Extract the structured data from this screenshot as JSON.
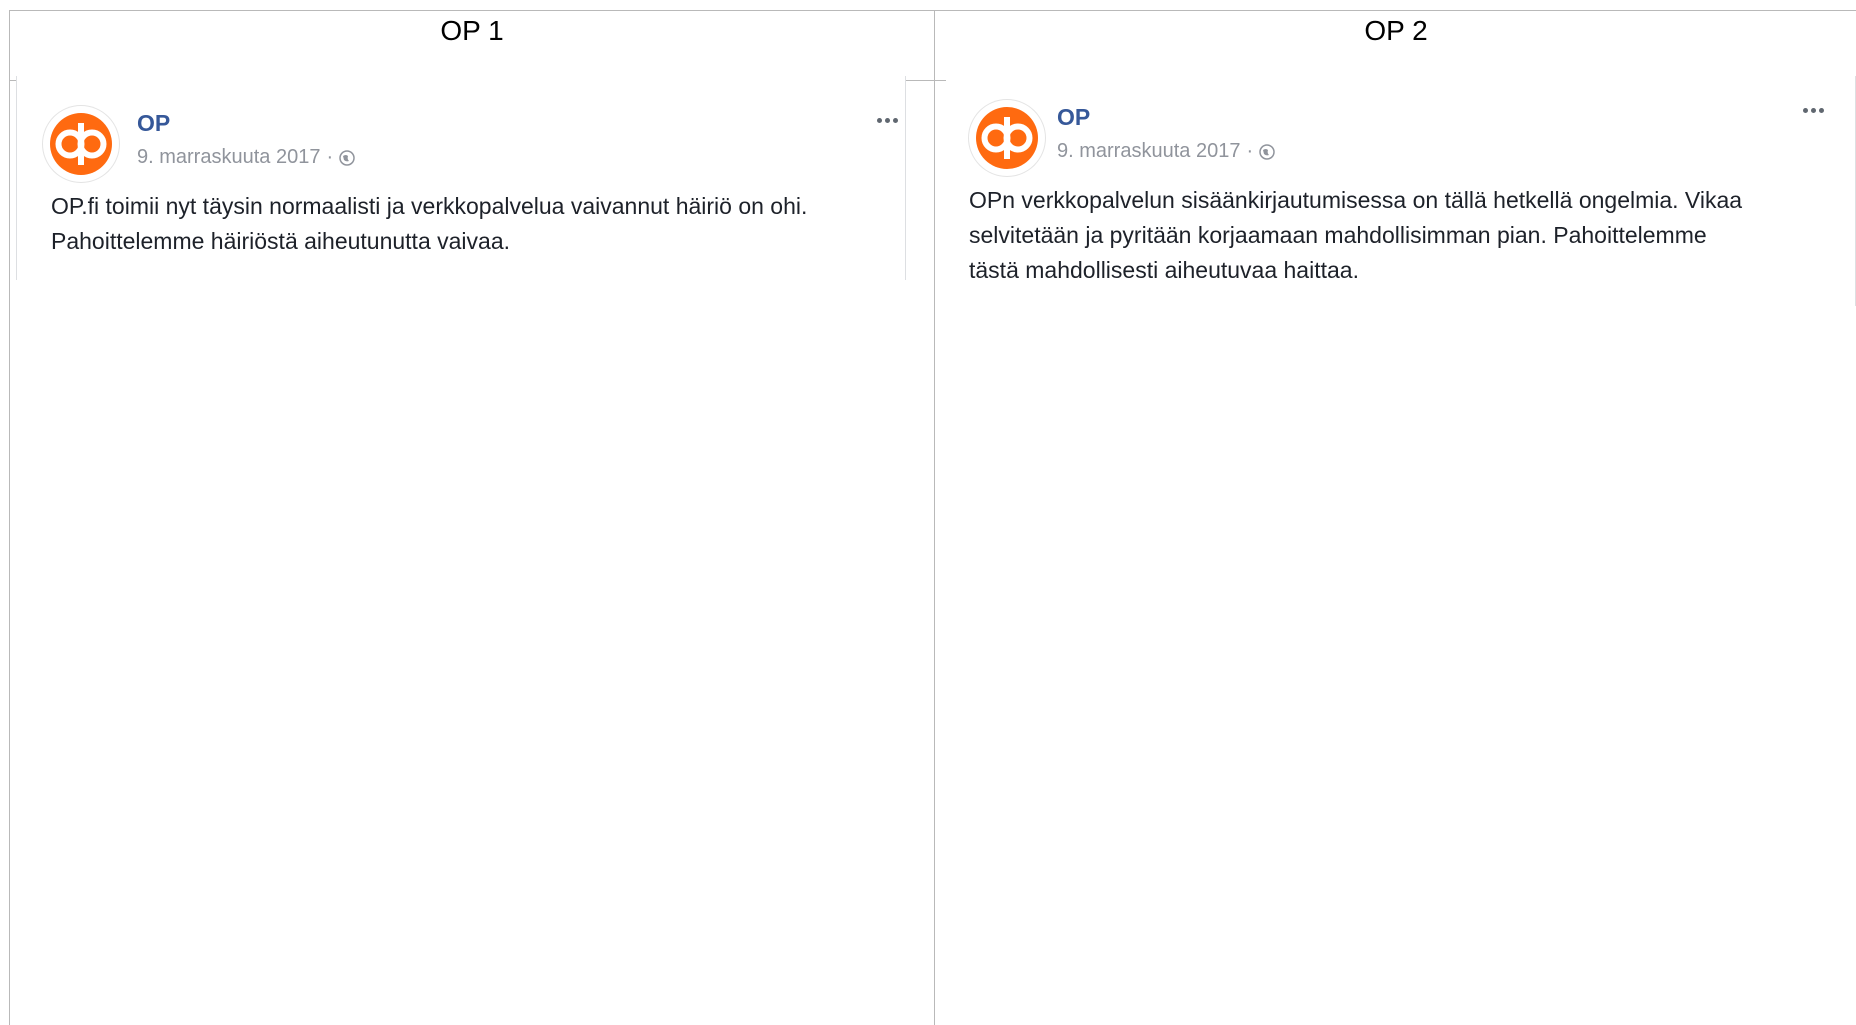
{
  "table": {
    "columns": [
      {
        "header": "OP 1"
      },
      {
        "header": "OP 2"
      }
    ]
  },
  "posts": [
    {
      "page_name": "OP",
      "date": "9. marraskuuta 2017",
      "separator": "·",
      "audience_icon": "globe-icon",
      "menu_icon": "more-options-icon",
      "avatar_icon": "op-logo-icon",
      "lines": [
        "OP.fi toimii nyt täysin normaalisti ja verkkopalvelua vaivannut häiriö on ohi.",
        "Pahoittelemme häiriöstä aiheutunutta vaivaa."
      ]
    },
    {
      "page_name": "OP",
      "date": "9. marraskuuta 2017",
      "separator": "·",
      "audience_icon": "globe-icon",
      "menu_icon": "more-options-icon",
      "avatar_icon": "op-logo-icon",
      "lines": [
        "OPn verkkopalvelun sisäänkirjautumisessa on tällä hetkellä ongelmia. Vikaa",
        "selvitetään ja pyritään korjaamaan mahdollisimman pian. Pahoittelemme",
        "tästä mahdollisesti aiheutuvaa haittaa."
      ]
    }
  ],
  "colors": {
    "brand_orange": "#ff6a10",
    "page_name_blue": "#365899",
    "meta_gray": "#90949c",
    "text_dark": "#1d2129",
    "table_border": "#b9b9b9"
  }
}
